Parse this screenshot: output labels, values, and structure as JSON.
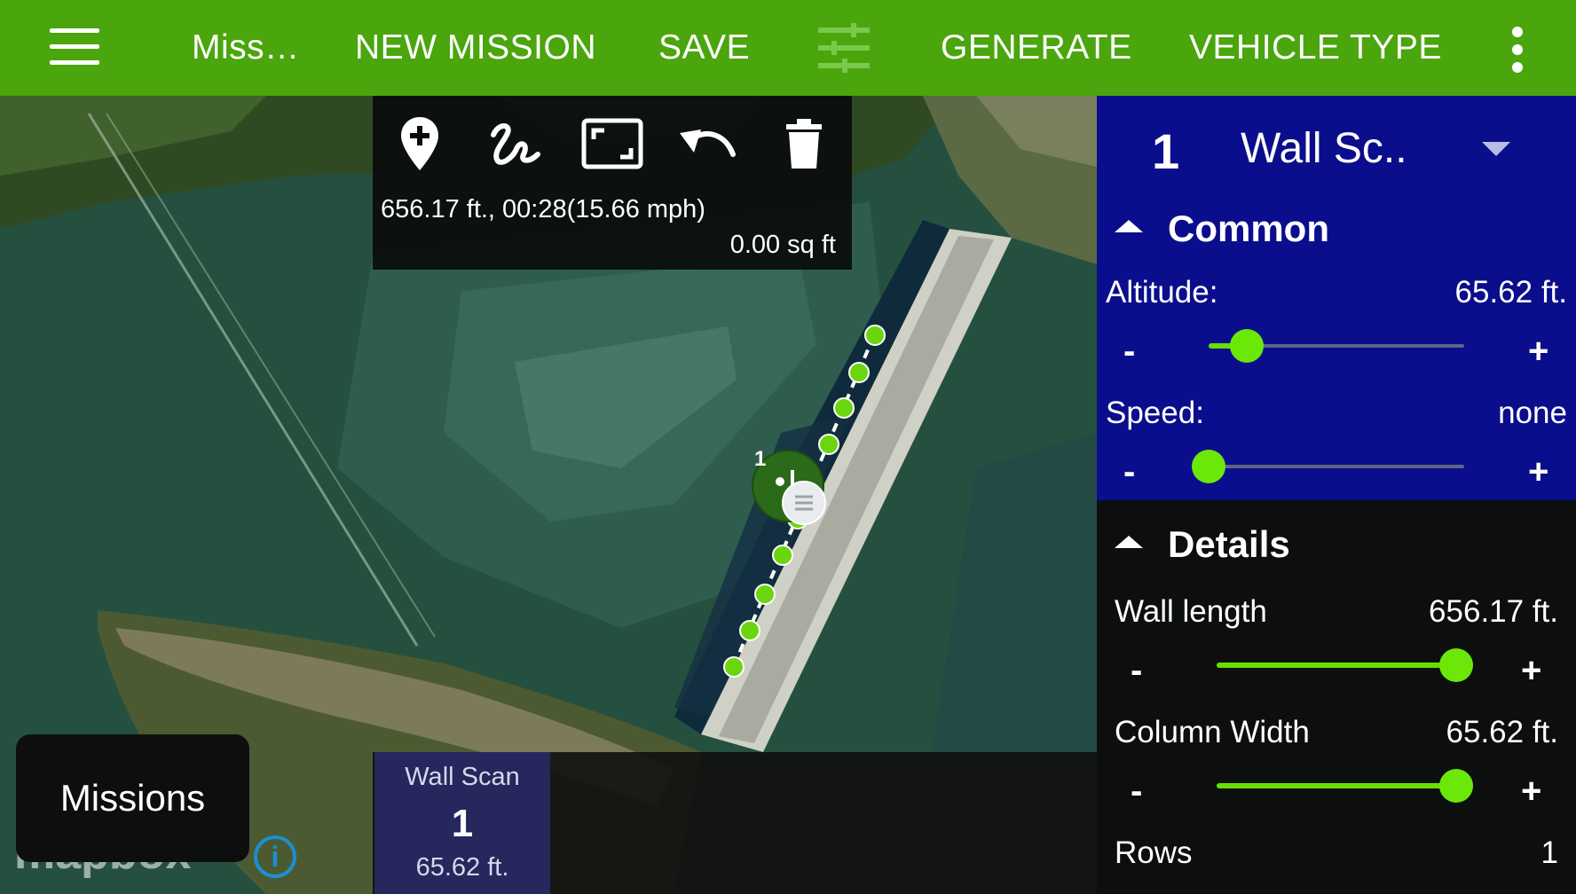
{
  "appbar": {
    "menu_icon": "hamburger-menu-icon",
    "mission_name": "Miss…",
    "new_mission": "NEW MISSION",
    "save": "SAVE",
    "settings_icon": "tune-sliders-icon",
    "generate": "GENERATE",
    "vehicle_type": "VEHICLE TYPE",
    "overflow_icon": "more-vert-icon",
    "bar_color": "#4aa60c"
  },
  "edit_toolbar": {
    "tools": [
      "add-waypoint-icon",
      "draw-path-icon",
      "fit-view-icon",
      "undo-icon",
      "delete-icon"
    ],
    "stats": "656.17 ft., 00:28(15.66 mph)",
    "area": "0.00 sq ft"
  },
  "map": {
    "selected_waypoint_label": "1",
    "attribution": "mapbox",
    "info_icon": "info-icon",
    "info_glyph": "i"
  },
  "panel": {
    "selected_number": "1",
    "selected_name": "Wall Sc..",
    "common": {
      "title": "Common",
      "altitude_label": "Altitude:",
      "altitude_value": "65.62 ft.",
      "altitude_level": 0.15,
      "speed_label": "Speed:",
      "speed_value": "none",
      "speed_level": 0.0,
      "background": "#0b0e8c"
    },
    "details": {
      "title": "Details",
      "wall_length_label": "Wall length",
      "wall_length_value": "656.17 ft.",
      "wall_length_level": 1.0,
      "column_width_label": "Column Width",
      "column_width_value": "65.62 ft.",
      "column_width_level": 1.0,
      "rows_label": "Rows",
      "rows_value": "1"
    },
    "minus": "-",
    "plus": "+"
  },
  "bottom": {
    "missions_button": "Missions",
    "card_title": "Wall Scan",
    "card_number": "1",
    "card_altitude": "65.62 ft."
  },
  "accent_green": "#67e000"
}
